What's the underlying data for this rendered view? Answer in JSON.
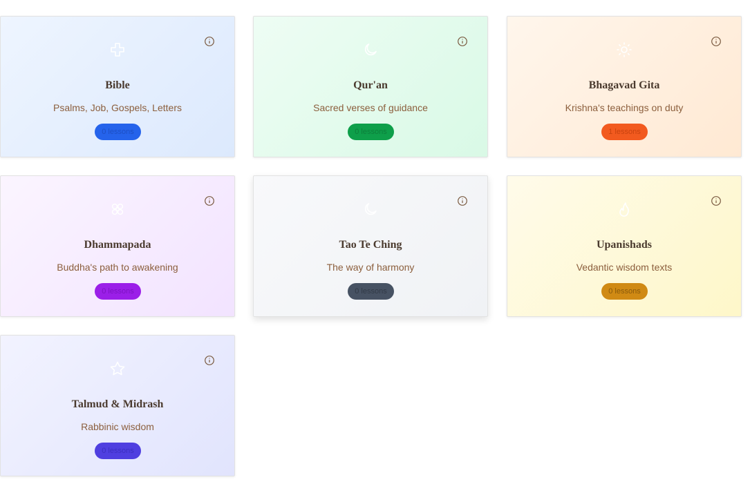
{
  "cards": [
    {
      "title": "Bible",
      "subtitle": "Psalms, Job, Gospels, Letters",
      "badge": "0 lessons",
      "icon": "cross-icon",
      "bg_from": "#eef5ff",
      "bg_to": "#dce9fd",
      "accent": "#2563eb",
      "badge_text": "#1d4fc4"
    },
    {
      "title": "Qur'an",
      "subtitle": "Sacred verses of guidance",
      "badge": "0 lessons",
      "icon": "crescent-moon-icon",
      "bg_from": "#eefdf4",
      "bg_to": "#d9f9e6",
      "accent": "#0e9f4a",
      "badge_text": "#0c7f3b"
    },
    {
      "title": "Bhagavad Gita",
      "subtitle": "Krishna's teachings on duty",
      "badge": "1 lessons",
      "icon": "sun-icon",
      "bg_from": "#fff6ec",
      "bg_to": "#ffe9d3",
      "accent": "#f25a1f",
      "badge_text": "#c9430f"
    },
    {
      "title": "Dhammapada",
      "subtitle": "Buddha's path to awakening",
      "badge": "0 lessons",
      "icon": "flower-icon",
      "bg_from": "#fbf5ff",
      "bg_to": "#f2e3ff",
      "accent": "#9b1fe8",
      "badge_text": "#7d12c2"
    },
    {
      "title": "Tao Te Ching",
      "subtitle": "The way of harmony",
      "badge": "0 lessons",
      "icon": "crescent-moon-icon",
      "bg_from": "#f8f9fb",
      "bg_to": "#f0f2f5",
      "accent": "#475263",
      "badge_text": "#323a47"
    },
    {
      "title": "Upanishads",
      "subtitle": "Vedantic wisdom texts",
      "badge": "0 lessons",
      "icon": "flame-icon",
      "bg_from": "#fffbea",
      "bg_to": "#fef7c9",
      "accent": "#d08a14",
      "badge_text": "#8a5a0a"
    },
    {
      "title": "Talmud & Midrash",
      "subtitle": "Rabbinic wisdom",
      "badge": "0 lessons",
      "icon": "star-icon",
      "bg_from": "#f2f3ff",
      "bg_to": "#e1e4fd",
      "accent": "#4f3fe0",
      "badge_text": "#3c2fc0"
    }
  ],
  "info_icon": "info-icon"
}
